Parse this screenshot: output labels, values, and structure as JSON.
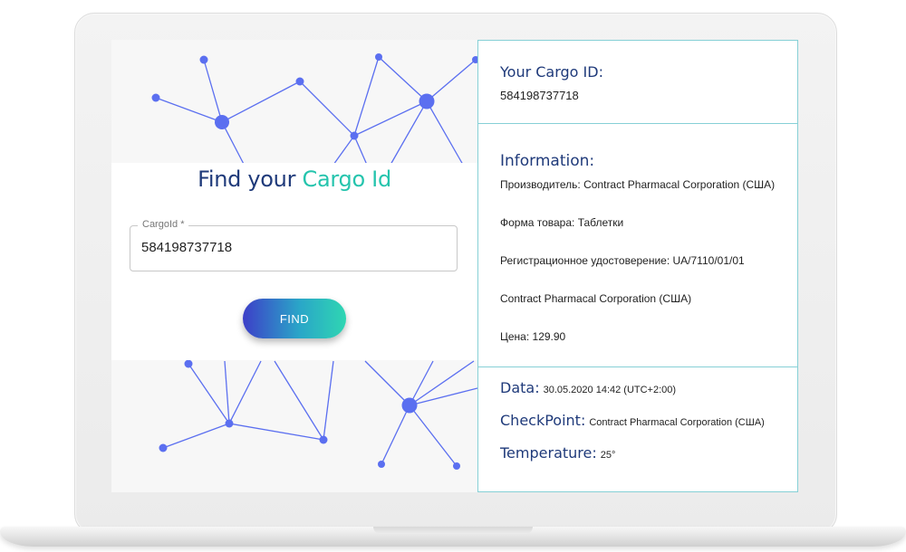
{
  "form": {
    "title_part1": "Find your",
    "title_part2": "Cargo Id",
    "field_label": "CargoId *",
    "field_value": "584198737718",
    "button_label": "FIND"
  },
  "cargo": {
    "heading": "Your Cargo ID:",
    "id": "584198737718"
  },
  "information": {
    "heading": "Information:",
    "lines": [
      "Производитель: Contract Pharmacal Corporation (США)",
      "Форма товара: Таблетки",
      "Регистрационное удостоверение: UA/7110/01/01",
      "Contract Pharmacal Corporation (США)",
      "Цена: 129.90"
    ]
  },
  "status": {
    "data_label": "Data:",
    "data_value": "30.05.2020 14:42 (UTC+2:00)",
    "checkpoint_label": "CheckPoint:",
    "checkpoint_value": "Contract Pharmacal Corporation (США)",
    "temperature_label": "Temperature:",
    "temperature_value": "25°"
  },
  "colors": {
    "brand_navy": "#1f3a7a",
    "brand_teal": "#25c4ad",
    "network_line": "#5b6ff0",
    "panel_border": "#86d0d6"
  }
}
